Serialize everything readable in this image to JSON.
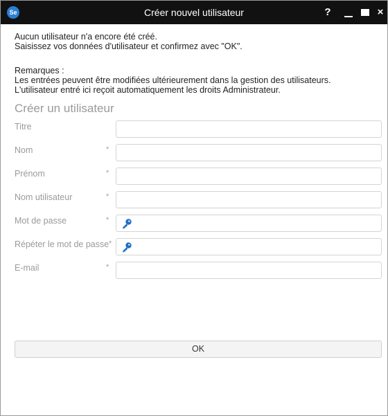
{
  "window": {
    "app_logo_text": "Se",
    "title": "Créer nouvel utilisateur",
    "help_label": "?",
    "close_label": "×"
  },
  "intro": {
    "line1": "Aucun utilisateur n'a encore été créé.",
    "line2": "Saisissez vos données d'utilisateur et confirmez avec \"OK\"."
  },
  "remarks": {
    "heading": "Remarques :",
    "line1": "Les entrées peuvent être modifiées ultérieurement dans la gestion des utilisateurs.",
    "line2": "L'utilisateur entré ici reçoit automatiquement les droits Administrateur."
  },
  "form": {
    "heading": "Créer un utilisateur",
    "required_marker": "*",
    "fields": [
      {
        "label": "Titre",
        "required": false,
        "value": ""
      },
      {
        "label": "Nom",
        "required": true,
        "value": ""
      },
      {
        "label": "Prénom",
        "required": true,
        "value": ""
      },
      {
        "label": "Nom utilisateur",
        "required": true,
        "value": ""
      },
      {
        "label": "Mot de passe",
        "required": true,
        "value": "",
        "icon": "key-icon"
      },
      {
        "label": "Répéter le mot de passe",
        "required": true,
        "value": "",
        "icon": "key-icon"
      },
      {
        "label": "E-mail",
        "required": true,
        "value": ""
      }
    ],
    "ok_label": "OK"
  },
  "colors": {
    "titlebar": "#111111",
    "logo": "#2a7fd4",
    "key_icon": "#1e6fc8"
  }
}
